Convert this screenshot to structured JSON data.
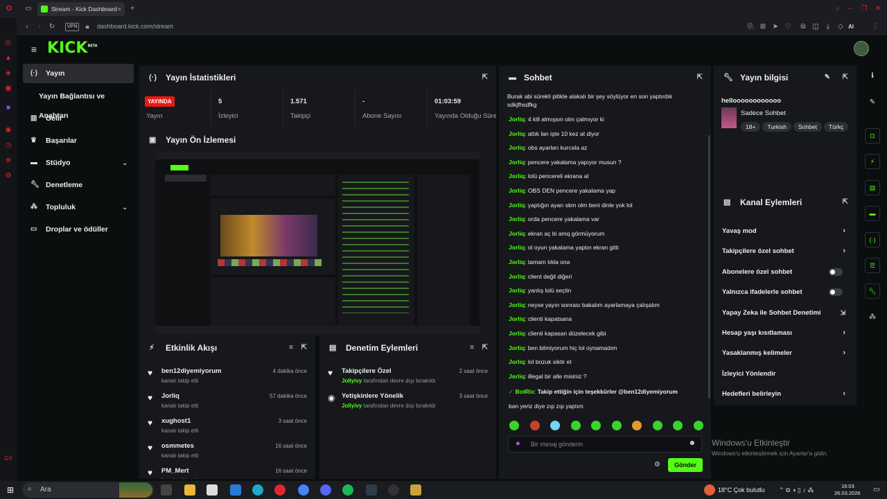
{
  "browser": {
    "tab_title": "Stream - Kick Dashboard",
    "vpn": "VPN",
    "url": "dashboard.kick.com/stream",
    "ai_label": "AI"
  },
  "logo": {
    "text": "KICK",
    "sup": "BETA"
  },
  "nav": [
    {
      "label": "Yayın",
      "icon": "broadcast-icon",
      "active": true
    },
    {
      "label": "Yayın Bağlantısı ve Anahtarı",
      "icon": ""
    },
    {
      "label": "Gelir",
      "icon": "revenue-icon"
    },
    {
      "label": "Başarılar",
      "icon": "trophy-icon"
    },
    {
      "label": "Stüdyo",
      "icon": "studio-icon",
      "chevron": true
    },
    {
      "label": "Denetleme",
      "icon": "moderation-icon"
    },
    {
      "label": "Topluluk",
      "icon": "community-icon",
      "chevron": true
    },
    {
      "label": "Droplar ve ödüller",
      "icon": "drops-icon"
    }
  ],
  "stats": {
    "title": "Yayın İstatistikleri",
    "live_badge": "YAYINDA",
    "live_label": "Yayın",
    "viewers": {
      "value": "5",
      "label": "İzleyici"
    },
    "followers": {
      "value": "1.571",
      "label": "Takipçi"
    },
    "subs": {
      "value": "-",
      "label": "Abone Sayısı"
    },
    "uptime": {
      "value": "01:03:59",
      "label": "Yayında Olduğu Süre"
    }
  },
  "preview": {
    "title": "Yayın Ön İzlemesi"
  },
  "activity": {
    "title": "Etkinlik Akışı",
    "items": [
      {
        "name": "ben12diyemiyorum",
        "sub": "kanalı takip etti",
        "time": "4 dakika önce"
      },
      {
        "name": "Jorliq",
        "sub": "kanalı takip etti",
        "time": "57 dakika önce"
      },
      {
        "name": "xughost1",
        "sub": "kanalı takip etti",
        "time": "3 saat önce"
      },
      {
        "name": "osmmetes",
        "sub": "kanalı takip etti",
        "time": "16 saat önce"
      },
      {
        "name": "PM_Mert",
        "sub": "kanalı takip etti",
        "time": "16 saat önce"
      }
    ]
  },
  "modactions": {
    "title": "Denetim Eylemleri",
    "items": [
      {
        "name": "Takipçilere Özel",
        "user": "Jollyivy",
        "sub": "tarafından devre dışı bırakıldı",
        "time": "2 saat önce"
      },
      {
        "name": "Yetişkinlere Yönelik",
        "user": "Jollyivy",
        "sub": "tarafından devre dışı bırakıldı",
        "time": "3 saat önce"
      }
    ]
  },
  "chat": {
    "title": "Sohbet",
    "top_text": "Burak abi sürekli pitikle alakalı bir şey söylüyor en son yaptırdık sdkjfhsdfkg",
    "messages": [
      {
        "user": "Jorliq",
        "text": "4 kill almışsın olm çalmıyor ki"
      },
      {
        "user": "Jorliq",
        "text": "attık lan işte 10 kez at diyor"
      },
      {
        "user": "Jorliq",
        "text": "obs ayarları kurcala az"
      },
      {
        "user": "Jorliq",
        "text": "pencere yakalama yapıyor musun ?"
      },
      {
        "user": "Jorliq",
        "text": "lolü pencereli ekrana al"
      },
      {
        "user": "Jorliq",
        "text": "OBS DEN pencere yakalama yap"
      },
      {
        "user": "Jorliq",
        "text": "yaptığın ayarı skm olm beni dinle yok lol"
      },
      {
        "user": "Jorliq",
        "text": "orda pencere yakalama var"
      },
      {
        "user": "Jorliq",
        "text": "ekran aç bi amq görmüyorum"
      },
      {
        "user": "Jorliq",
        "text": "ol oyun yakalama yaptın ekran gitti"
      },
      {
        "user": "Jorliq",
        "text": "tamam tıkla ona"
      },
      {
        "user": "Jorliq",
        "text": "client değil diğeri"
      },
      {
        "user": "Jorliq",
        "text": "yanlış lolü seçtin"
      },
      {
        "user": "Jorliq",
        "text": "neyse yayın sonrası bakalım ayarlamaya çalışalım"
      },
      {
        "user": "Jorliq",
        "text": "clienti kapatsana"
      },
      {
        "user": "Jorliq",
        "text": "clienti kapasan düzelecek gibi"
      },
      {
        "user": "Jorliq",
        "text": "ben bilmiyorum hiç lol oynamadım"
      },
      {
        "user": "Jorliq",
        "text": "lol bozuk siktir et"
      },
      {
        "user": "Jorliq",
        "text": "illegal bir alle misiniz ?"
      },
      {
        "user": "BotRix",
        "text": "Takip ettiğin için teşekkürler @ben12diyemiyorum"
      },
      {
        "user": "",
        "text": "ban yeriz diye zıp zıp yaptım"
      }
    ],
    "input_placeholder": "Bir mesaj gönderin",
    "send_label": "Gönder"
  },
  "streaminfo": {
    "title": "Yayın bilgisi",
    "stream_title": "helloooooooooooo",
    "category": "Sadece Sohbet",
    "tags": [
      "18+",
      "Turkish",
      "Sohbet",
      "Türkç"
    ]
  },
  "channel_actions": {
    "title": "Kanal Eylemleri",
    "items": [
      {
        "label": "Yavaş mod",
        "control": "arrow"
      },
      {
        "label": "Takipçilere özel sohbet",
        "control": "arrow"
      },
      {
        "label": "Abonelere özel sohbet",
        "control": "toggle"
      },
      {
        "label": "Yalnızca ifadelerle sohbet",
        "control": "toggle"
      },
      {
        "label": "Yapay Zeka ile Sohbet Denetimi",
        "control": "external"
      },
      {
        "label": "Hesap yaşı kısıtlaması",
        "control": "arrow"
      },
      {
        "label": "Yasaklanmış kelimeler",
        "control": "arrow"
      },
      {
        "label": "İzleyici Yönlendir",
        "control": "none"
      },
      {
        "label": "Hedefleri belirleyin",
        "control": "arrow"
      }
    ]
  },
  "windows": {
    "activate_title": "Windows'u Etkinleştir",
    "activate_sub": "Windows'u etkinleştirmek için Ayarlar'a gidin.",
    "search": "Ara",
    "weather": "18°C  Çok bulutlu",
    "time": "16:03",
    "date": "26.03.2026"
  },
  "colors": {
    "accent": "#53fc18",
    "live": "#e91916",
    "panel": "#16181b",
    "bg": "#0b0e0f"
  }
}
